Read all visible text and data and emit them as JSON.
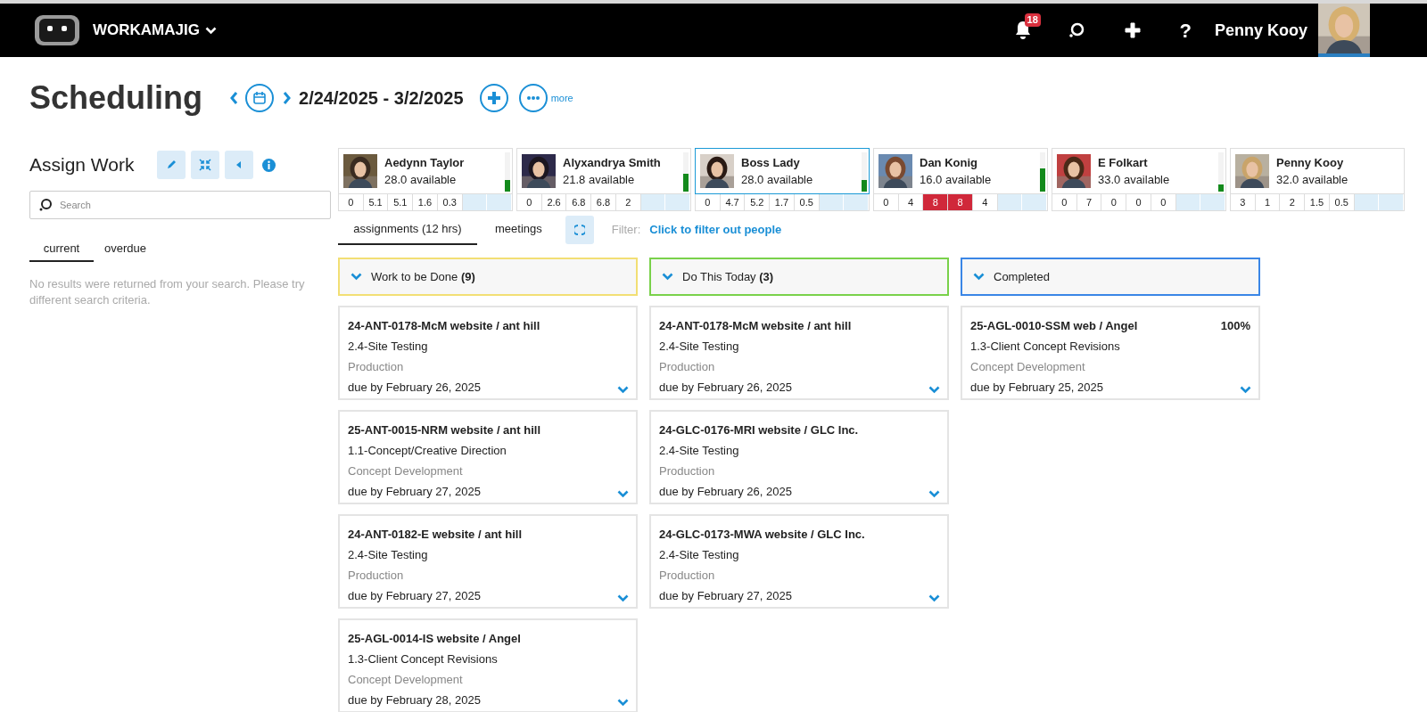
{
  "app": {
    "name": "WORKAMAJIG"
  },
  "topbar": {
    "notifications": "18",
    "help": "?",
    "user": "Penny Kooy"
  },
  "page": {
    "title": "Scheduling",
    "date_range": "2/24/2025 - 3/2/2025",
    "more": "more"
  },
  "assign": {
    "title": "Assign Work",
    "search": {
      "placeholder": "Search"
    },
    "tabs": [
      {
        "label": "current",
        "selected": true
      },
      {
        "label": "overdue",
        "selected": false
      }
    ],
    "empty_message": "No results were returned from your search. Please try different search criteria."
  },
  "people": [
    {
      "name": "Aedynn Taylor",
      "available": "28.0 available",
      "selected": false,
      "level": 0.3,
      "hours": [
        {
          "value": "0",
          "over": false
        },
        {
          "value": "5.1",
          "over": false
        },
        {
          "value": "5.1",
          "over": false
        },
        {
          "value": "1.6",
          "over": false
        },
        {
          "value": "0.3",
          "over": false
        }
      ]
    },
    {
      "name": "Alyxandrya Smith",
      "available": "21.8 available",
      "selected": false,
      "level": 0.45,
      "hours": [
        {
          "value": "0",
          "over": false
        },
        {
          "value": "2.6",
          "over": false
        },
        {
          "value": "6.8",
          "over": false
        },
        {
          "value": "6.8",
          "over": false
        },
        {
          "value": "2",
          "over": false
        }
      ]
    },
    {
      "name": "Boss Lady",
      "available": "28.0 available",
      "selected": true,
      "level": 0.3,
      "hours": [
        {
          "value": "0",
          "over": false
        },
        {
          "value": "4.7",
          "over": false
        },
        {
          "value": "5.2",
          "over": false
        },
        {
          "value": "1.7",
          "over": false
        },
        {
          "value": "0.5",
          "over": false
        }
      ]
    },
    {
      "name": "Dan Konig",
      "available": "16.0 available",
      "selected": false,
      "level": 0.6,
      "hours": [
        {
          "value": "0",
          "over": false
        },
        {
          "value": "4",
          "over": false
        },
        {
          "value": "8",
          "over": true
        },
        {
          "value": "8",
          "over": true
        },
        {
          "value": "4",
          "over": false
        }
      ]
    },
    {
      "name": "E Folkart",
      "available": "33.0 available",
      "selected": false,
      "level": 0.18,
      "hours": [
        {
          "value": "0",
          "over": false
        },
        {
          "value": "7",
          "over": false
        },
        {
          "value": "0",
          "over": false
        },
        {
          "value": "0",
          "over": false
        },
        {
          "value": "0",
          "over": false
        }
      ]
    },
    {
      "name": "Penny Kooy",
      "available": "32.0 available",
      "selected": false,
      "hours": [
        {
          "value": "3",
          "over": false
        },
        {
          "value": "1",
          "over": false
        },
        {
          "value": "2",
          "over": false
        },
        {
          "value": "1.5",
          "over": false
        },
        {
          "value": "0.5",
          "over": false
        }
      ]
    }
  ],
  "view_tabs": [
    {
      "label": "assignments (12 hrs)",
      "selected": true
    },
    {
      "label": "meetings",
      "selected": false
    }
  ],
  "filter": {
    "label": "Filter:",
    "link": "Click to filter out people"
  },
  "columns": [
    {
      "title": "Work to be Done **(9)**",
      "color": "#f2df74",
      "cards": [
        {
          "project": "24-ANT-0178-McM website / ant hill",
          "task": "2.4-Site Testing",
          "phase": "Production",
          "due": "due by February 26, 2025"
        },
        {
          "project": "25-ANT-0015-NRM website / ant hill",
          "task": "1.1-Concept/Creative Direction",
          "phase": "Concept Development",
          "due": "due by February 27, 2025"
        },
        {
          "project": "24-ANT-0182-E website / ant hill",
          "task": "2.4-Site Testing",
          "phase": "Production",
          "due": "due by February 27, 2025"
        },
        {
          "project": "25-AGL-0014-IS website / Angel",
          "task": "1.3-Client Concept Revisions",
          "phase": "Concept Development",
          "due": "due by February 28, 2025"
        }
      ]
    },
    {
      "title": "Do This Today **(3)**",
      "color": "#79d14a",
      "cards": [
        {
          "project": "24-ANT-0178-McM website / ant hill",
          "task": "2.4-Site Testing",
          "phase": "Production",
          "due": "due by February 26, 2025"
        },
        {
          "project": "24-GLC-0176-MRI website / GLC Inc.",
          "task": "2.4-Site Testing",
          "phase": "Production",
          "due": "due by February 26, 2025"
        },
        {
          "project": "24-GLC-0173-MWA website / GLC Inc.",
          "task": "2.4-Site Testing",
          "phase": "Production",
          "due": "due by February 27, 2025"
        }
      ]
    },
    {
      "title": "Completed",
      "color": "#3a86e6",
      "cards": [
        {
          "project": "25-AGL-0010-SSM web / Angel",
          "percent": "100%",
          "task": "1.3-Client Concept Revisions",
          "phase": "Concept Development",
          "due": "due by February 25, 2025"
        }
      ]
    }
  ]
}
